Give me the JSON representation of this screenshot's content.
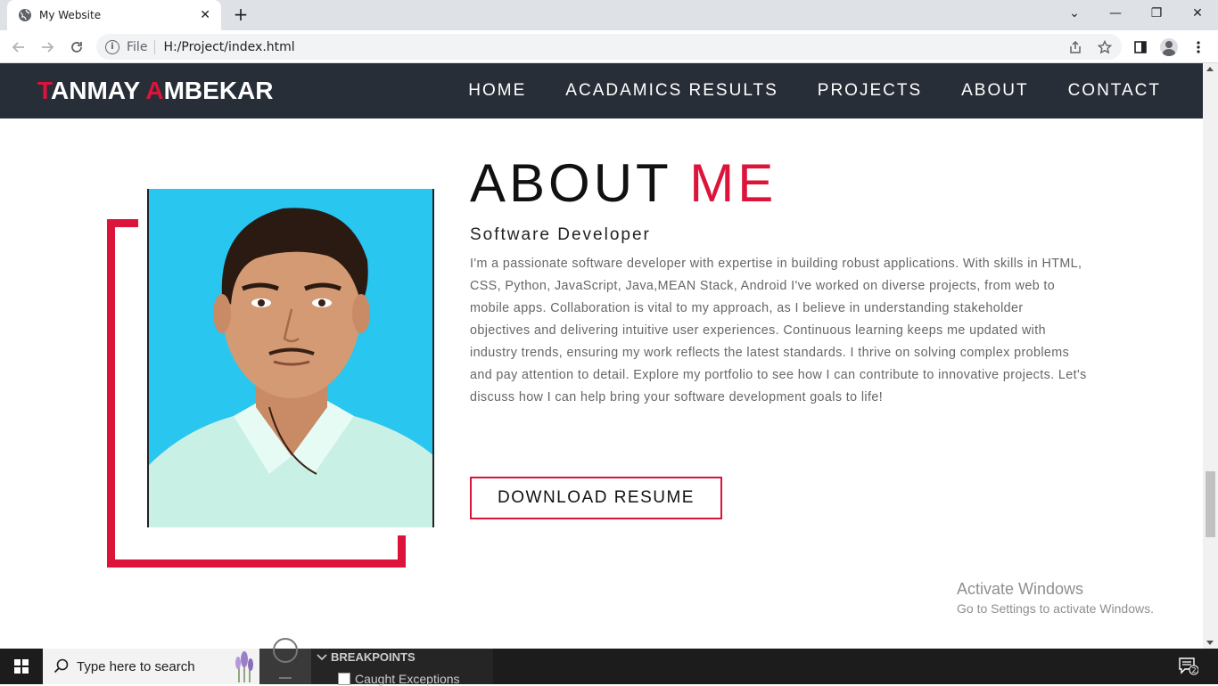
{
  "browser": {
    "tab_title": "My Website",
    "tab_close": "✕",
    "new_tab": "+",
    "window_controls": [
      "⌄",
      "—",
      "❐",
      "✕"
    ],
    "info_icon": "i",
    "scheme_label": "File",
    "url": "H:/Project/index.html"
  },
  "site": {
    "logo": {
      "first_initial": "T",
      "first_rest": "ANMAY ",
      "last_initial": "A",
      "last_rest": "MBEKAR"
    },
    "nav": [
      "HOME",
      "ACADAMICS RESULTS",
      "PROJECTS",
      "ABOUT",
      "CONTACT"
    ],
    "about": {
      "title_main": "ABOUT ",
      "title_accent": "ME",
      "subtitle": "Software Developer",
      "bio": "I'm a passionate software developer with expertise in building robust applications. With skills in HTML, CSS, Python, JavaScript, Java,MEAN Stack, Android I've worked on diverse projects, from web to mobile apps. Collaboration is vital to my approach, as I believe in understanding stakeholder objectives and delivering intuitive user experiences. Continuous learning keeps me updated with industry trends, ensuring my work reflects the latest standards. I thrive on solving complex problems and pay attention to detail. Explore my portfolio to see how I can contribute to innovative projects. Let's discuss how I can help bring your software development goals to life!",
      "button": "DOWNLOAD RESUME"
    },
    "accent_color": "#dc143c",
    "nav_bg_color": "#272e37"
  },
  "watermark": {
    "line1": "Activate Windows",
    "line2": "Go to Settings to activate Windows."
  },
  "taskbar": {
    "search_placeholder": "Type here to search",
    "panel_header": "BREAKPOINTS",
    "panel_item": "Caught Exceptions",
    "notification_count": "2"
  }
}
